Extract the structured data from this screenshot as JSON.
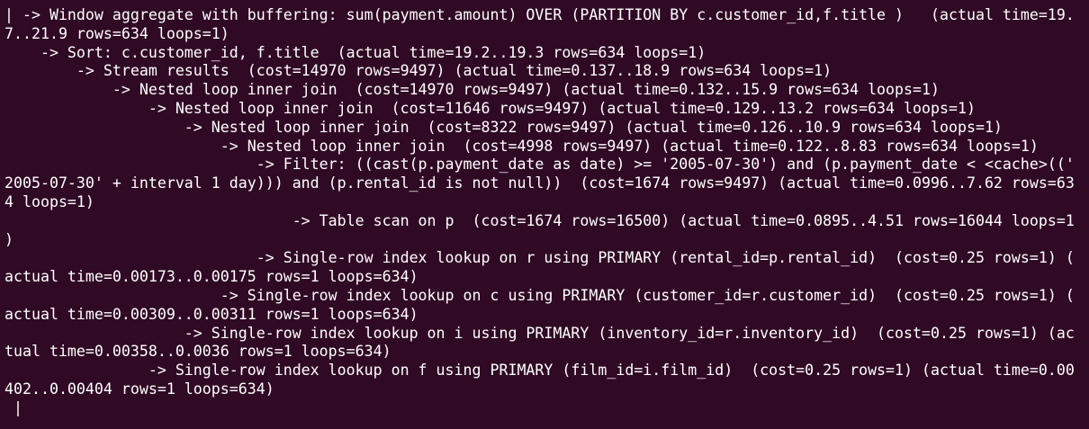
{
  "colors": {
    "background": "#300a24",
    "foreground": "#ffffff"
  },
  "terminal": {
    "lines": [
      "| -> Window aggregate with buffering: sum(payment.amount) OVER (PARTITION BY c.customer_id,f.title )   (actual time=19.",
      "7..21.9 rows=634 loops=1)",
      "    -> Sort: c.customer_id, f.title  (actual time=19.2..19.3 rows=634 loops=1)",
      "        -> Stream results  (cost=14970 rows=9497) (actual time=0.137..18.9 rows=634 loops=1)",
      "            -> Nested loop inner join  (cost=14970 rows=9497) (actual time=0.132..15.9 rows=634 loops=1)",
      "                -> Nested loop inner join  (cost=11646 rows=9497) (actual time=0.129..13.2 rows=634 loops=1)",
      "                    -> Nested loop inner join  (cost=8322 rows=9497) (actual time=0.126..10.9 rows=634 loops=1)",
      "                        -> Nested loop inner join  (cost=4998 rows=9497) (actual time=0.122..8.83 rows=634 loops=1)",
      "                            -> Filter: ((cast(p.payment_date as date) >= '2005-07-30') and (p.payment_date < <cache>(('",
      "2005-07-30' + interval 1 day))) and (p.rental_id is not null))  (cost=1674 rows=9497) (actual time=0.0996..7.62 rows=63",
      "4 loops=1)",
      "                                -> Table scan on p  (cost=1674 rows=16500) (actual time=0.0895..4.51 rows=16044 loops=1",
      ")",
      "                            -> Single-row index lookup on r using PRIMARY (rental_id=p.rental_id)  (cost=0.25 rows=1) (",
      "actual time=0.00173..0.00175 rows=1 loops=634)",
      "                        -> Single-row index lookup on c using PRIMARY (customer_id=r.customer_id)  (cost=0.25 rows=1) (",
      "actual time=0.00309..0.00311 rows=1 loops=634)",
      "                    -> Single-row index lookup on i using PRIMARY (inventory_id=r.inventory_id)  (cost=0.25 rows=1) (ac",
      "tual time=0.00358..0.0036 rows=1 loops=634)",
      "                -> Single-row index lookup on f using PRIMARY (film_id=i.film_id)  (cost=0.25 rows=1) (actual time=0.00",
      "402..0.00404 rows=1 loops=634)"
    ],
    "cursor_line": " |"
  }
}
